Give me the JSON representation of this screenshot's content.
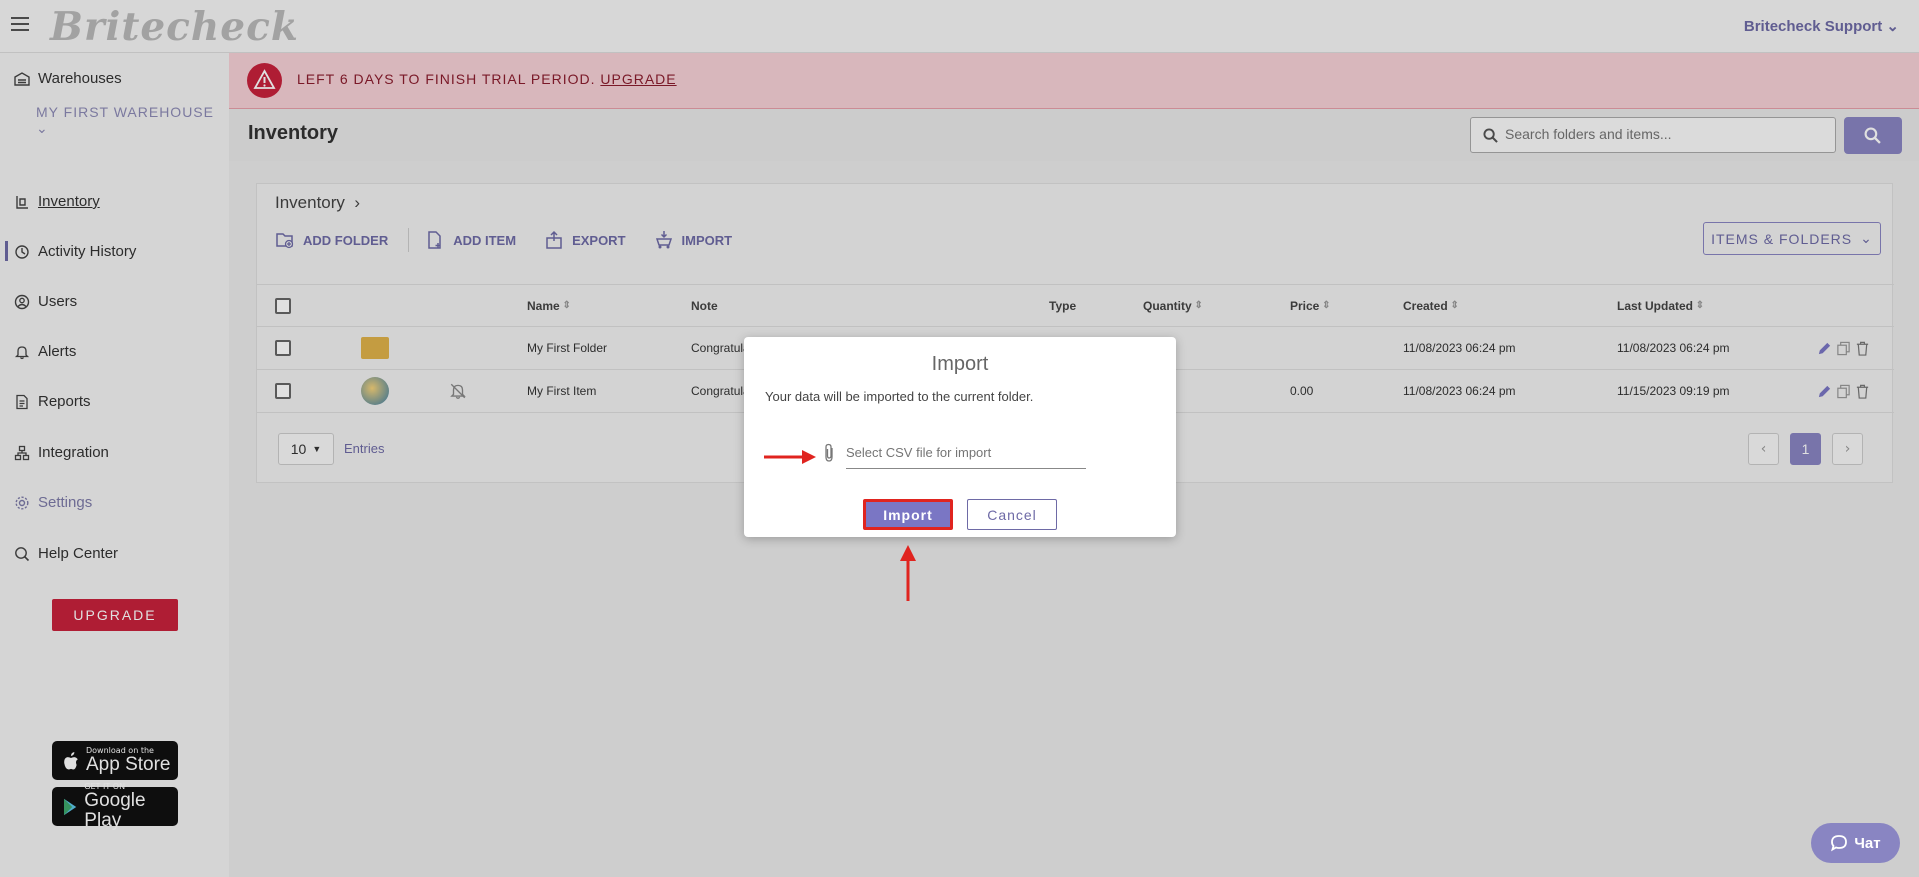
{
  "header": {
    "logo": "Britecheck",
    "user_menu": "Britecheck Support"
  },
  "sidebar": {
    "warehouses_label": "Warehouses",
    "warehouse_selected": "MY FIRST WAREHOUSE",
    "items": [
      {
        "label": "Inventory",
        "icon": "inventory-icon",
        "active": true
      },
      {
        "label": "Activity History",
        "icon": "history-icon"
      },
      {
        "label": "Users",
        "icon": "user-icon"
      },
      {
        "label": "Alerts",
        "icon": "bell-icon"
      },
      {
        "label": "Reports",
        "icon": "report-icon"
      },
      {
        "label": "Integration",
        "icon": "integration-icon"
      },
      {
        "label": "Settings",
        "icon": "gear-icon"
      },
      {
        "label": "Help Center",
        "icon": "help-icon"
      }
    ],
    "upgrade_label": "UPGRADE",
    "app_store": {
      "small": "Download on the",
      "big": "App Store"
    },
    "google_play": {
      "small": "GET IT ON",
      "big": "Google Play"
    }
  },
  "banner": {
    "text": "LEFT 6 DAYS TO FINISH TRIAL PERIOD.",
    "link": "UPGRADE"
  },
  "page": {
    "title": "Inventory",
    "search_placeholder": "Search folders and items..."
  },
  "panel": {
    "breadcrumb": "Inventory",
    "toolbar": {
      "add_folder": "ADD FOLDER",
      "add_item": "ADD ITEM",
      "export": "EXPORT",
      "import": "IMPORT"
    },
    "view_select": "ITEMS & FOLDERS",
    "columns": {
      "name": "Name",
      "note": "Note",
      "type": "Type",
      "quantity": "Quantity",
      "price": "Price",
      "created": "Created",
      "updated": "Last Updated"
    },
    "rows": [
      {
        "name": "My First Folder",
        "note": "Congratula",
        "price": "",
        "created": "11/08/2023 06:24 pm",
        "updated": "11/08/2023 06:24 pm"
      },
      {
        "name": "My First Item",
        "note": "Congratula",
        "price": "0.00",
        "created": "11/08/2023 06:24 pm",
        "updated": "11/15/2023 09:19 pm"
      }
    ],
    "page_size": "10",
    "entries_label": "Entries",
    "current_page": "1"
  },
  "modal": {
    "title": "Import",
    "description": "Your data will be imported to the current folder.",
    "file_placeholder": "Select CSV file for import",
    "import_label": "Import",
    "cancel_label": "Cancel"
  },
  "chat": {
    "label": "Чат"
  },
  "colors": {
    "accent": "#8985c2",
    "danger": "#c8223c",
    "highlight": "#e0241f"
  }
}
